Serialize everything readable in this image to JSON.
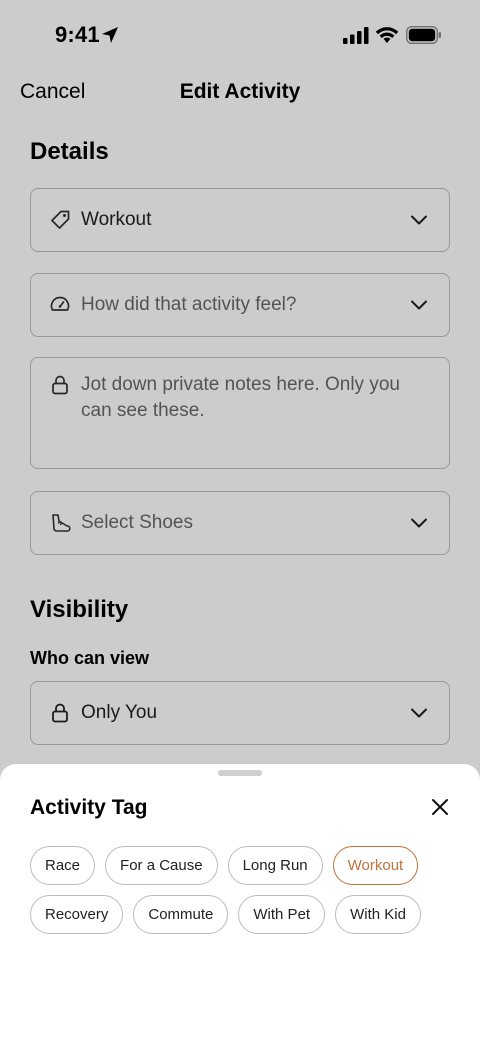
{
  "status_bar": {
    "time": "9:41"
  },
  "nav": {
    "cancel_label": "Cancel",
    "title": "Edit Activity"
  },
  "details": {
    "section_title": "Details",
    "activity_type": {
      "value": "Workout",
      "icon": "tag-icon"
    },
    "perceived_exertion": {
      "placeholder": "How did that activity feel?",
      "icon": "gauge-icon"
    },
    "private_notes": {
      "placeholder": "Jot down private notes here. Only you can see these.",
      "icon": "lock-icon"
    },
    "shoes": {
      "placeholder": "Select Shoes",
      "icon": "shoe-icon"
    }
  },
  "visibility": {
    "section_title": "Visibility",
    "who_can_view_label": "Who can view",
    "value": "Only You",
    "icon": "lock-icon"
  },
  "activity_tag_sheet": {
    "title": "Activity Tag",
    "tags_row1": [
      {
        "label": "Race",
        "selected": false
      },
      {
        "label": "For a Cause",
        "selected": false
      },
      {
        "label": "Long Run",
        "selected": false
      },
      {
        "label": "Workout",
        "selected": true
      }
    ],
    "tags_row2": [
      {
        "label": "Recovery",
        "selected": false
      },
      {
        "label": "Commute",
        "selected": false
      },
      {
        "label": "With Pet",
        "selected": false
      },
      {
        "label": "With Kid",
        "selected": false
      }
    ]
  },
  "colors": {
    "accent": "#c0713a",
    "border": "#bfbfbf"
  }
}
